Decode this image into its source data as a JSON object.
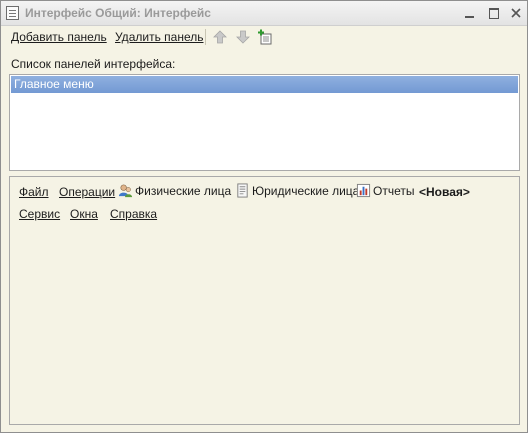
{
  "window": {
    "title": "Интерфейс Общий: Интерфейс"
  },
  "toolbar": {
    "add_panel": "Добавить панель",
    "remove_panel": "Удалить панель",
    "icons": [
      "arrow-up-icon",
      "arrow-down-icon",
      "new-item-icon"
    ]
  },
  "list": {
    "label": "Список панелей интерфейса:",
    "items": [
      {
        "label": "Главное меню",
        "selected": true
      }
    ]
  },
  "preview": {
    "row1": [
      {
        "label": "Файл",
        "icon": null
      },
      {
        "label": "Операции",
        "icon": null
      },
      {
        "label": "Физические лица",
        "icon": "persons-icon"
      },
      {
        "label": "Юридические лица",
        "icon": "document-icon"
      },
      {
        "label": "Отчеты",
        "icon": "report-chart-icon"
      },
      {
        "label": "<Новая>",
        "icon": null
      }
    ],
    "row2": [
      {
        "label": "Сервис"
      },
      {
        "label": "Окна"
      },
      {
        "label": "Справка"
      }
    ]
  },
  "colors": {
    "form_background": "#f5f3e5",
    "selection": "#7fa3d9",
    "border": "#a9a9a9"
  }
}
